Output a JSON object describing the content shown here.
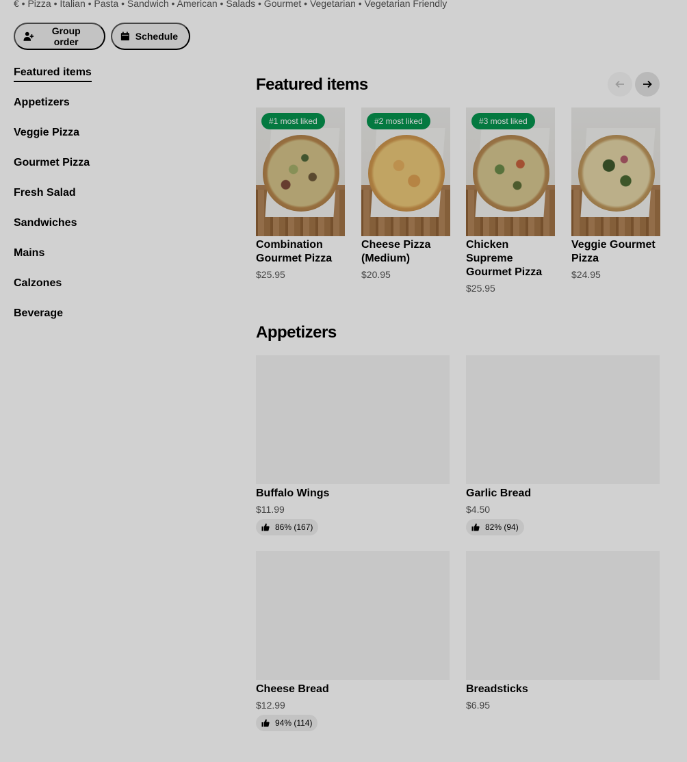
{
  "header": {
    "cuisines": "€ • Pizza • Italian • Pasta • Sandwich • American • Salads • Gourmet • Vegetarian • Vegetarian Friendly",
    "group_order_label": "Group order",
    "schedule_label": "Schedule"
  },
  "sidebar": {
    "items": [
      {
        "label": "Featured items",
        "active": true
      },
      {
        "label": "Appetizers"
      },
      {
        "label": "Veggie Pizza"
      },
      {
        "label": "Gourmet Pizza"
      },
      {
        "label": "Fresh Salad"
      },
      {
        "label": "Sandwiches"
      },
      {
        "label": "Mains"
      },
      {
        "label": "Calzones"
      },
      {
        "label": "Beverage"
      }
    ]
  },
  "featured": {
    "title": "Featured items",
    "items": [
      {
        "badge": "#1 most liked",
        "name": "Combination Gourmet Pizza",
        "price": "$25.95"
      },
      {
        "badge": "#2 most liked",
        "name": "Cheese Pizza (Medium)",
        "price": "$20.95"
      },
      {
        "badge": "#3 most liked",
        "name": "Chicken Supreme Gourmet Pizza",
        "price": "$25.95"
      },
      {
        "badge": "",
        "name": "Veggie Gourmet Pizza",
        "price": "$24.95"
      }
    ]
  },
  "appetizers": {
    "title": "Appetizers",
    "items": [
      {
        "name": "Buffalo Wings",
        "price": "$11.99",
        "rating": "86% (167)"
      },
      {
        "name": "Garlic Bread",
        "price": "$4.50",
        "rating": "82% (94)"
      },
      {
        "name": "Cheese Bread",
        "price": "$12.99",
        "rating": "94% (114)"
      },
      {
        "name": "Breadsticks",
        "price": "$6.95",
        "rating": ""
      }
    ]
  },
  "colors": {
    "badge_green": "#05944f",
    "pill_gray": "#eeeeee",
    "secondary_text": "#545454"
  },
  "icons": {
    "group_order": "add-person-icon",
    "schedule": "calendar-icon",
    "carousel_prev": "arrow-left-icon",
    "carousel_next": "arrow-right-icon",
    "rating": "thumbs-up-icon"
  }
}
